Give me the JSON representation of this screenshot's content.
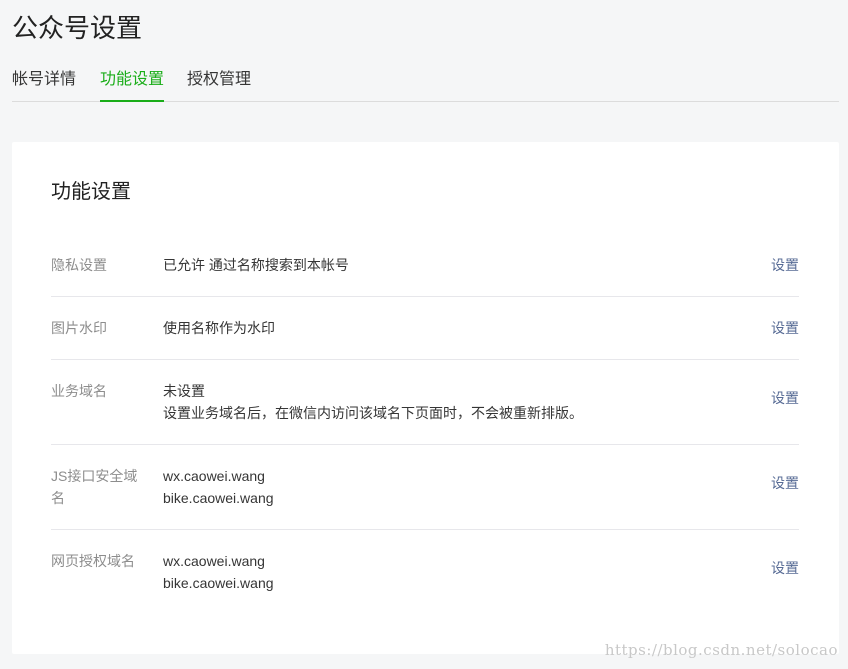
{
  "page": {
    "title": "公众号设置"
  },
  "tabs": [
    {
      "label": "帐号详情",
      "active": false
    },
    {
      "label": "功能设置",
      "active": true
    },
    {
      "label": "授权管理",
      "active": false
    }
  ],
  "colors": {
    "accent": "#1aad19",
    "link": "#576b95",
    "background": "#f5f6f7"
  },
  "card": {
    "title": "功能设置",
    "rows": [
      {
        "label": "隐私设置",
        "value_lines": [
          "已允许 通过名称搜索到本帐号"
        ],
        "action": "设置"
      },
      {
        "label": "图片水印",
        "value_lines": [
          "使用名称作为水印"
        ],
        "action": "设置"
      },
      {
        "label": "业务域名",
        "value_lines": [
          "未设置",
          "设置业务域名后，在微信内访问该域名下页面时，不会被重新排版。"
        ],
        "action": "设置"
      },
      {
        "label": "JS接口安全域名",
        "value_lines": [
          "wx.caowei.wang",
          "bike.caowei.wang"
        ],
        "action": "设置"
      },
      {
        "label": "网页授权域名",
        "value_lines": [
          "wx.caowei.wang",
          "bike.caowei.wang"
        ],
        "action": "设置"
      }
    ]
  },
  "watermark": "https://blog.csdn.net/solocao"
}
